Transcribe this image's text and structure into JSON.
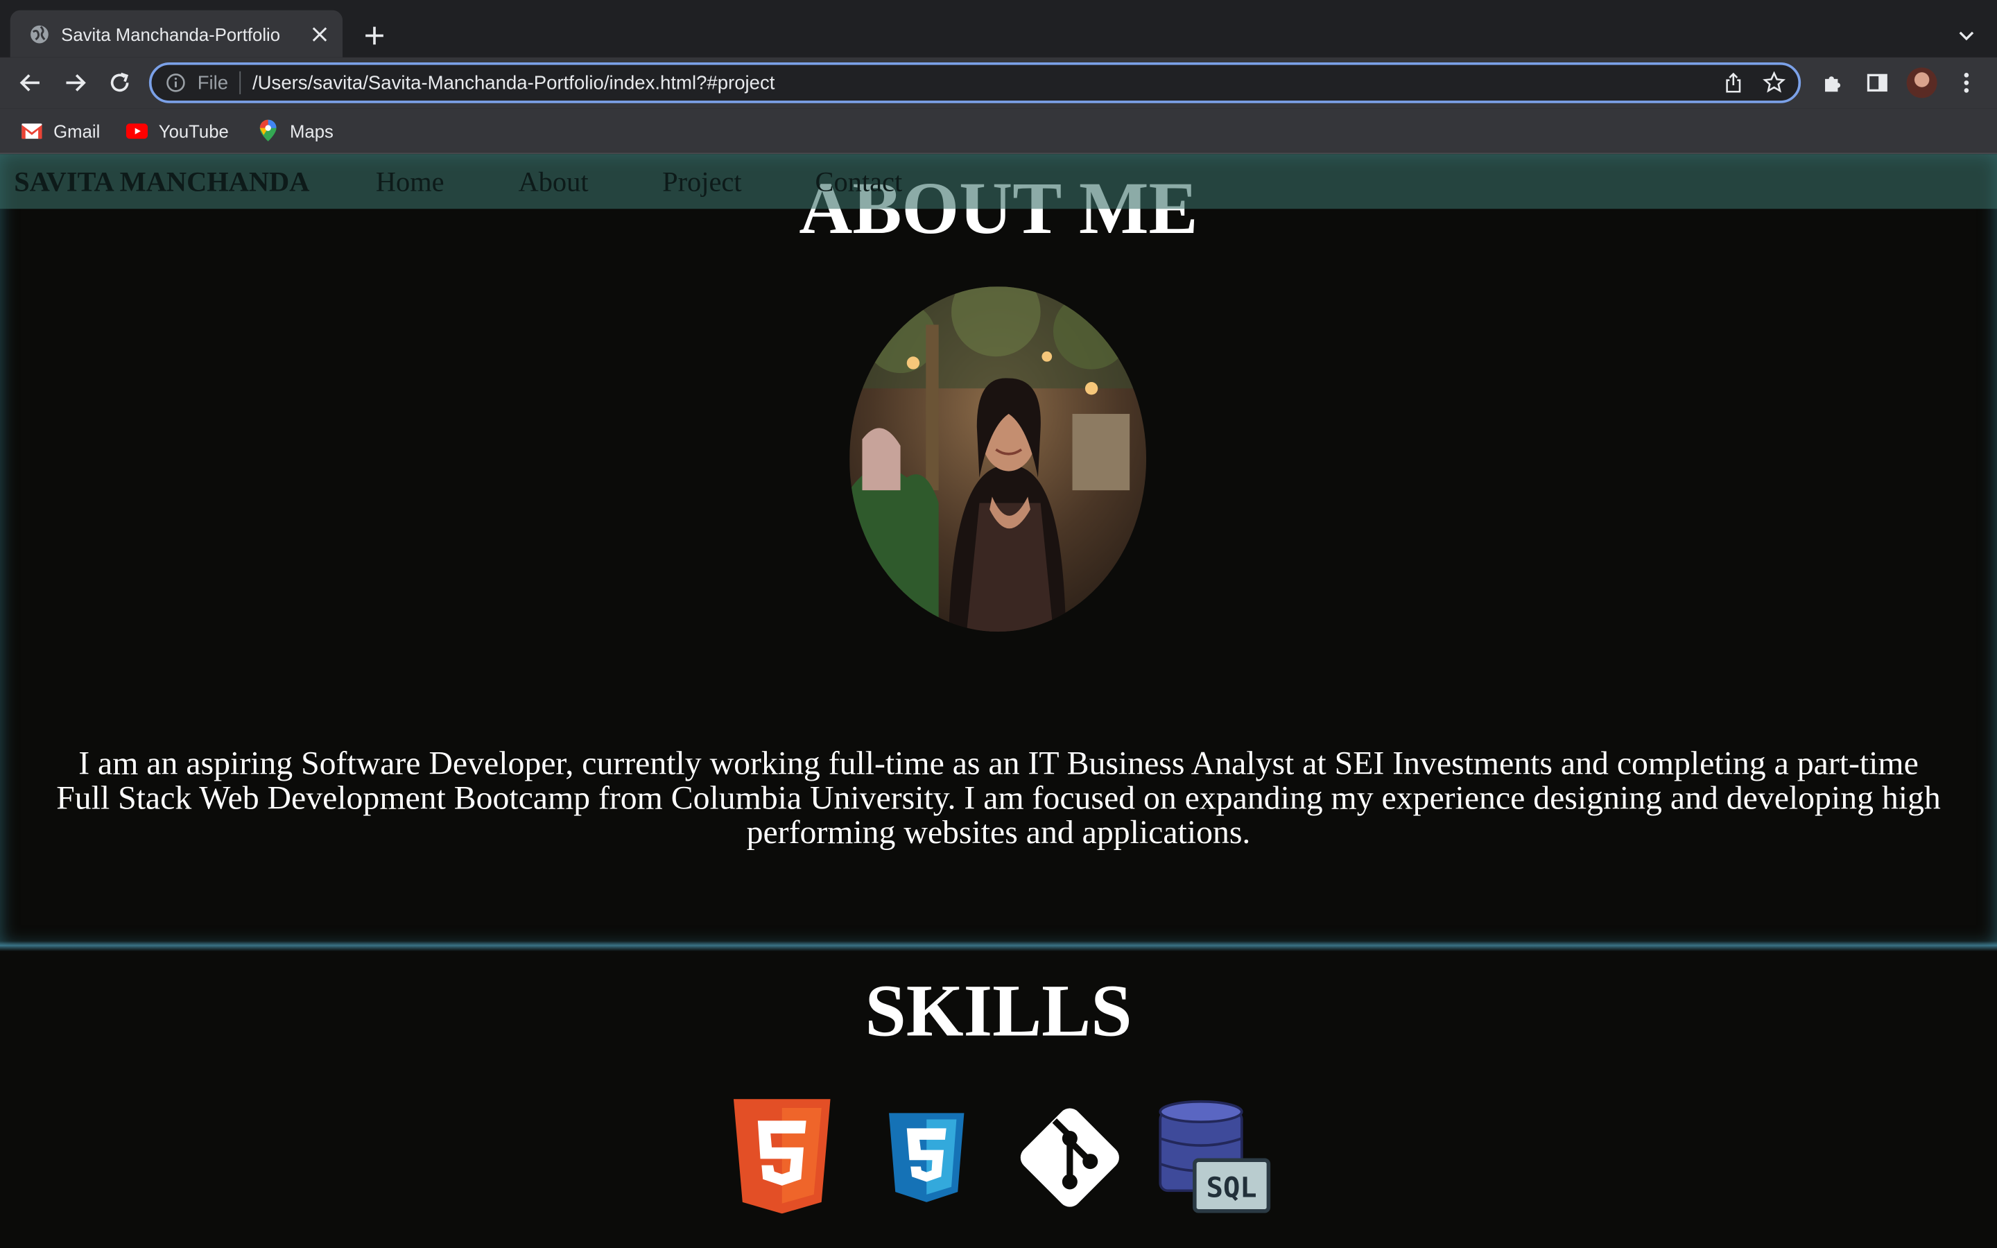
{
  "browser": {
    "tab_title": "Savita Manchanda-Portfolio",
    "url_scheme": "File",
    "url": "/Users/savita/Savita-Manchanda-Portfolio/index.html?#project",
    "bookmarks": [
      {
        "label": "Gmail",
        "icon": "gmail-icon"
      },
      {
        "label": "YouTube",
        "icon": "youtube-icon"
      },
      {
        "label": "Maps",
        "icon": "maps-icon"
      }
    ]
  },
  "nav": {
    "brand": "SAVITA MANCHANDA",
    "links": [
      "Home",
      "About",
      "Project",
      "Contact"
    ]
  },
  "about": {
    "title": "ABOUT ME",
    "text": "I am an aspiring Software Developer, currently working full-time as an IT Business Analyst at SEI Investments and completing a part-time Full Stack Web Development Bootcamp from Columbia University. I am focused on expanding my experience designing and developing high performing websites and applications."
  },
  "skills": {
    "title": "SKILLS",
    "items": [
      {
        "name": "HTML5",
        "icon": "html5-icon",
        "number": "5"
      },
      {
        "name": "CSS3",
        "icon": "css3-icon",
        "number": "3"
      },
      {
        "name": "Git",
        "icon": "git-icon"
      },
      {
        "name": "SQL",
        "icon": "sql-database-icon",
        "label": "SQL"
      }
    ]
  },
  "colors": {
    "page_bg": "#0b0b09",
    "navbar_bg": "#3f7a74",
    "omnibox_focus": "#7ba1e8",
    "html5_orange": "#e34f26",
    "css3_blue": "#1572b6"
  }
}
